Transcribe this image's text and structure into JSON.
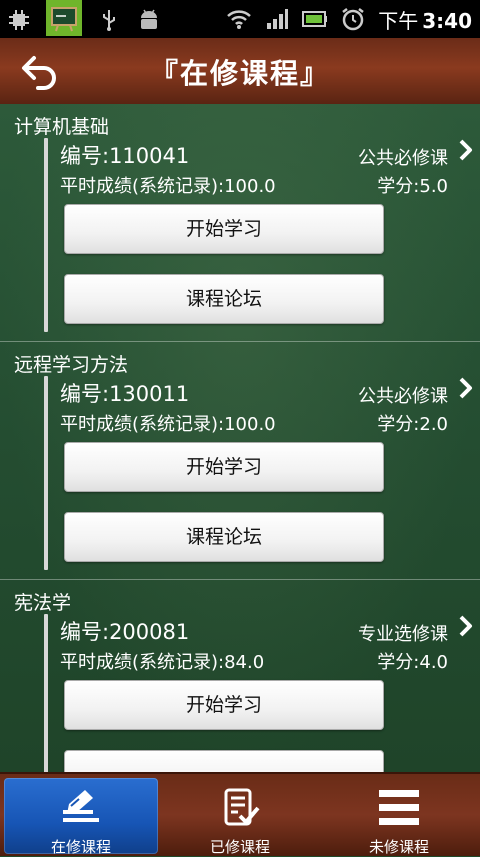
{
  "status_bar": {
    "ampm": "下午",
    "time": "3:40",
    "icons": [
      "chip-icon",
      "chalkboard-app-icon",
      "usb-icon",
      "android-icon",
      "wifi-icon",
      "signal-icon",
      "battery-icon",
      "alarm-icon"
    ]
  },
  "header": {
    "title": "『在修课程』",
    "back_icon": "back-arrow-icon"
  },
  "courses": [
    {
      "name": "计算机基础",
      "code": "编号:110041",
      "type": "公共必修课",
      "score": "平时成绩(系统记录):100.0",
      "credit": "学分:5.0",
      "study_button": "开始学习",
      "forum_button": "课程论坛"
    },
    {
      "name": "远程学习方法",
      "code": "编号:130011",
      "type": "公共必修课",
      "score": "平时成绩(系统记录):100.0",
      "credit": "学分:2.0",
      "study_button": "开始学习",
      "forum_button": "课程论坛"
    },
    {
      "name": "宪法学",
      "code": "编号:200081",
      "type": "专业选修课",
      "score": "平时成绩(系统记录):84.0",
      "credit": "学分:4.0",
      "study_button": "开始学习",
      "forum_button": ""
    }
  ],
  "tabs": [
    {
      "label": "在修课程",
      "icon": "edit-course-icon",
      "active": true
    },
    {
      "label": "已修课程",
      "icon": "checklist-icon",
      "active": false
    },
    {
      "label": "未修课程",
      "icon": "menu-list-icon",
      "active": false
    }
  ],
  "colors": {
    "header_brown": "#7a331c",
    "board_green": "#2a5535",
    "active_tab_blue": "#1f62c4"
  }
}
